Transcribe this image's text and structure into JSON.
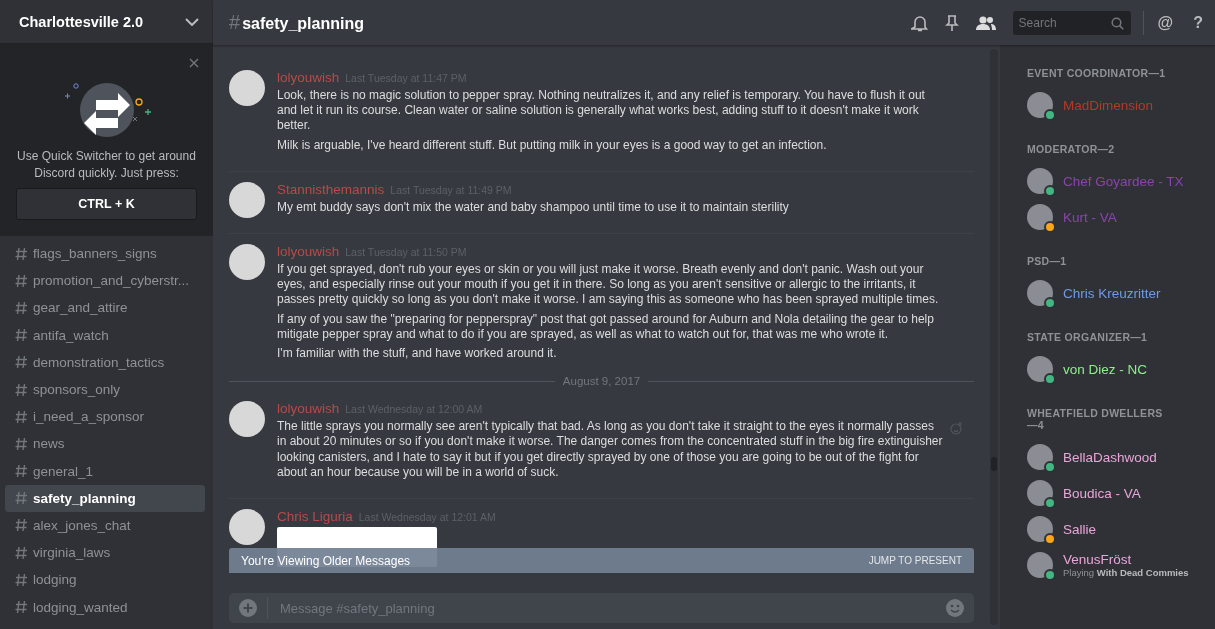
{
  "server": {
    "name": "Charlottesville 2.0"
  },
  "quick_switcher": {
    "text": "Use Quick Switcher to get around Discord quickly. Just press:",
    "shortcut": "CTRL + K"
  },
  "channels": [
    {
      "name": "flags_banners_signs",
      "selected": false
    },
    {
      "name": "promotion_and_cyberstr...",
      "selected": false
    },
    {
      "name": "gear_and_attire",
      "selected": false
    },
    {
      "name": "antifa_watch",
      "selected": false
    },
    {
      "name": "demonstration_tactics",
      "selected": false
    },
    {
      "name": "sponsors_only",
      "selected": false
    },
    {
      "name": "i_need_a_sponsor",
      "selected": false
    },
    {
      "name": "news",
      "selected": false
    },
    {
      "name": "general_1",
      "selected": false
    },
    {
      "name": "safety_planning",
      "selected": true
    },
    {
      "name": "alex_jones_chat",
      "selected": false
    },
    {
      "name": "virginia_laws",
      "selected": false
    },
    {
      "name": "lodging",
      "selected": false
    },
    {
      "name": "lodging_wanted",
      "selected": false
    }
  ],
  "header": {
    "hash": "#",
    "channel": "safety_planning",
    "search_placeholder": "Search",
    "mention": "@",
    "help": "?"
  },
  "messages": [
    {
      "kind": "message",
      "author": "lolyouwish",
      "color": "#b84a4a",
      "time": "Last Tuesday at 11:47 PM",
      "paragraphs": [
        "Look, there is no magic solution to pepper spray. Nothing neutralizes it, and any relief is temporary. You have to flush it out and let it run its course. Clean water or saline solution is generally what works best, adding stuff to it doesn't make it work better.",
        "Milk is arguable, I've heard different stuff. But putting milk in your eyes is a good way to get an infection."
      ]
    },
    {
      "kind": "message",
      "author": "Stannisthemannis",
      "color": "#b84a4a",
      "time": "Last Tuesday at 11:49 PM",
      "paragraphs": [
        "My emt buddy says don't mix the water and baby shampoo until time to use it to maintain sterility"
      ]
    },
    {
      "kind": "message",
      "author": "lolyouwish",
      "color": "#b84a4a",
      "time": "Last Tuesday at 11:50 PM",
      "paragraphs": [
        "If you get sprayed, don't rub your eyes or skin or you will just make it worse. Breath evenly and don't panic. Wash out your eyes, and especially rinse out your mouth if you get it in there. So long as you aren't sensitive or allergic to the irritants, it passes pretty quickly so long as you don't make it worse. I am saying this as someone who has been sprayed multiple times.",
        "If any of you saw the \"preparing for pepperspray\" post that got passed around for Auburn and Nola detailing the gear to help mitigate pepper spray and what to do if you are sprayed, as well as what to watch out for, that was me who wrote it.",
        "I'm familiar with the stuff, and have worked around it."
      ]
    },
    {
      "kind": "date",
      "label": "August 9, 2017"
    },
    {
      "kind": "message",
      "author": "lolyouwish",
      "color": "#b84a4a",
      "time": "Last Wednesday at 12:00 AM",
      "paragraphs": [
        "The little sprays you normally see aren't typically that bad. As long as you don't take it straight to the eyes it normally passes in about 20 minutes or so if you don't make it worse. The danger comes from the concentrated stuff in the big fire extinguisher looking canisters, and I hate to say it but if you get directly sprayed by one of those you are going to be out of the fight for about an hour because you will be in a world of suck."
      ]
    },
    {
      "kind": "attachment",
      "author": "Chris Liguria",
      "color": "#b84a4a",
      "time": "Last Wednesday at 12:01 AM"
    }
  ],
  "older_bar": {
    "text": "You're Viewing Older Messages",
    "action": "JUMP TO PRESENT"
  },
  "composer": {
    "placeholder": "Message #safety_planning"
  },
  "member_groups": [
    {
      "title": "EVENT COORDINATOR—1",
      "members": [
        {
          "name": "MadDimension",
          "color": "#b13a2b",
          "status_dot": {
            "color": "#43b581"
          }
        }
      ]
    },
    {
      "title": "MODERATOR—2",
      "members": [
        {
          "name": "Chef Goyardee - TX",
          "color": "#8a45aa",
          "status_dot": {
            "color": "#43b581"
          }
        },
        {
          "name": "Kurt - VA",
          "color": "#8a45aa",
          "status_dot": {
            "color": "#faa61a"
          }
        }
      ]
    },
    {
      "title": "PSD—1",
      "members": [
        {
          "name": "Chris Kreuzritter",
          "color": "#6e9ae8",
          "status_dot": {
            "color": "#43b581"
          }
        }
      ]
    },
    {
      "title": "STATE ORGANIZER—1",
      "members": [
        {
          "name": "von Diez - NC",
          "color": "#8ef08a",
          "status_dot": {
            "color": "#43b581"
          }
        }
      ]
    },
    {
      "title": "WHEATFIELD DWELLERS—4",
      "members": [
        {
          "name": "BellaDashwood",
          "color": "#e8a6d9",
          "status_dot": {
            "color": "#43b581"
          }
        },
        {
          "name": "Boudica - VA",
          "color": "#e8a6d9",
          "status_dot": {
            "color": "#43b581"
          }
        },
        {
          "name": "Sallie",
          "color": "#e8a6d9",
          "status_dot": {
            "color": "#faa61a"
          }
        },
        {
          "name": "VenusFröst",
          "color": "#e8a6d9",
          "status_dot": {
            "color": "#43b581"
          },
          "activity": "Playing **With Dead Commies**"
        }
      ]
    }
  ]
}
